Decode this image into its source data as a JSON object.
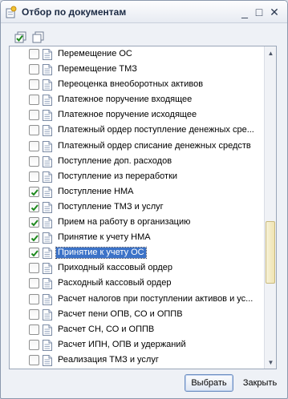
{
  "window": {
    "title": "Отбор по документам",
    "controls": {
      "minimize": "_",
      "maximize": "□",
      "close": "✕"
    }
  },
  "toolbar": {
    "check_all_icon": "check-all-icon",
    "uncheck_all_icon": "uncheck-all-icon"
  },
  "list": {
    "items": [
      {
        "label": "Перемещение ОС",
        "checked": false,
        "selected": false
      },
      {
        "label": "Перемещение ТМЗ",
        "checked": false,
        "selected": false
      },
      {
        "label": "Переоценка внеоборотных активов",
        "checked": false,
        "selected": false
      },
      {
        "label": "Платежное поручение входящее",
        "checked": false,
        "selected": false
      },
      {
        "label": "Платежное поручение исходящее",
        "checked": false,
        "selected": false
      },
      {
        "label": "Платежный ордер поступление денежных сре...",
        "checked": false,
        "selected": false
      },
      {
        "label": "Платежный ордер списание денежных средств",
        "checked": false,
        "selected": false
      },
      {
        "label": "Поступление доп. расходов",
        "checked": false,
        "selected": false
      },
      {
        "label": "Поступление из переработки",
        "checked": false,
        "selected": false
      },
      {
        "label": "Поступление НМА",
        "checked": true,
        "selected": false
      },
      {
        "label": "Поступление ТМЗ и услуг",
        "checked": true,
        "selected": false
      },
      {
        "label": "Прием на работу в организацию",
        "checked": true,
        "selected": false
      },
      {
        "label": "Принятие к учету НМА",
        "checked": true,
        "selected": false
      },
      {
        "label": "Принятие к учету ОС",
        "checked": true,
        "selected": true
      },
      {
        "label": "Приходный кассовый ордер",
        "checked": false,
        "selected": false
      },
      {
        "label": "Расходный кассовый ордер",
        "checked": false,
        "selected": false
      },
      {
        "label": "Расчет налогов при поступлении активов и ус...",
        "checked": false,
        "selected": false
      },
      {
        "label": "Расчет пени ОПВ, СО и ОППВ",
        "checked": false,
        "selected": false
      },
      {
        "label": "Расчет СН, СО и ОППВ",
        "checked": false,
        "selected": false
      },
      {
        "label": "Расчет ИПН, ОПВ и удержаний",
        "checked": false,
        "selected": false
      },
      {
        "label": "Реализация ТМЗ и услуг",
        "checked": false,
        "selected": false
      }
    ]
  },
  "footer": {
    "select_label": "Выбрать",
    "close_label": "Закрыть"
  },
  "colors": {
    "selection": "#3c73c8",
    "checkmark": "#1e8a1e",
    "window_bg": "#eef1f6"
  }
}
